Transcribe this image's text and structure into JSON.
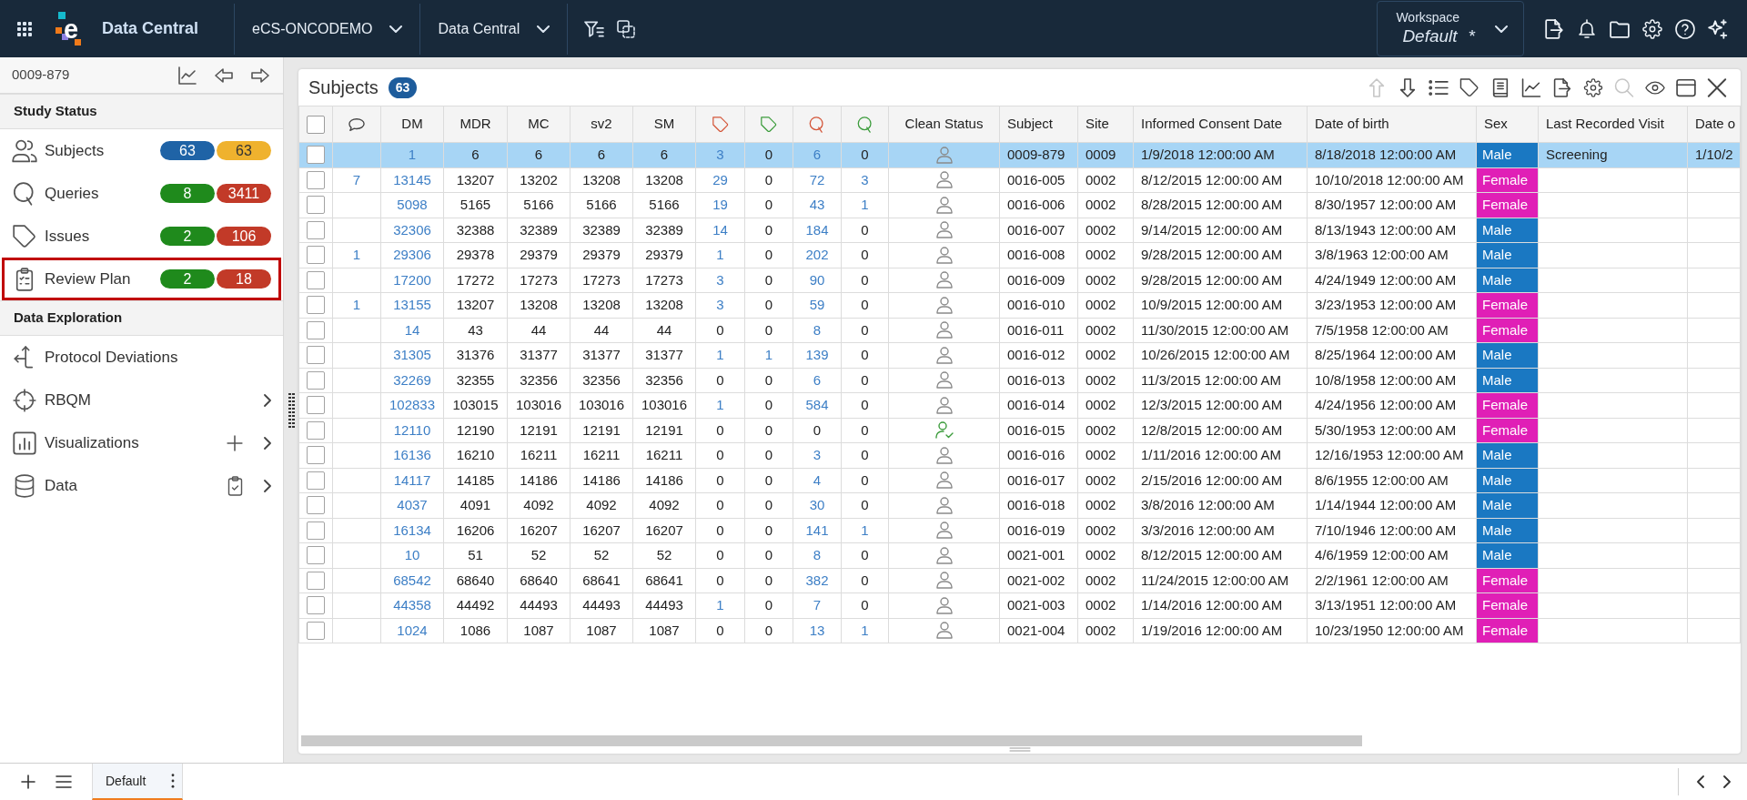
{
  "top_bar": {
    "logo_text": "e",
    "app_title": "Data Central",
    "selectors": [
      {
        "label": "eCS-ONCODEMO"
      },
      {
        "label": "Data Central"
      }
    ],
    "workspace": {
      "caption": "Workspace",
      "name": "Default",
      "modified_mark": "*"
    }
  },
  "sidebar": {
    "subject": "0009-879",
    "sections": [
      {
        "title": "Study Status",
        "items": [
          {
            "label": "Subjects",
            "highlighted": false,
            "submenu": false,
            "badges": [
              {
                "text": "63",
                "color": "#1f63a6"
              },
              {
                "text": "63",
                "color": "#efb22e"
              }
            ]
          },
          {
            "label": "Queries",
            "highlighted": false,
            "submenu": false,
            "badges": [
              {
                "text": "8",
                "color": "#1f8a1c"
              },
              {
                "text": "3411",
                "color": "#c23a28"
              }
            ]
          },
          {
            "label": "Issues",
            "highlighted": false,
            "submenu": false,
            "badges": [
              {
                "text": "2",
                "color": "#1f8a1c"
              },
              {
                "text": "106",
                "color": "#c23a28"
              }
            ]
          },
          {
            "label": "Review Plan",
            "highlighted": true,
            "submenu": false,
            "badges": [
              {
                "text": "2",
                "color": "#1f8a1c"
              },
              {
                "text": "18",
                "color": "#c23a28"
              }
            ]
          }
        ]
      },
      {
        "title": "Data Exploration",
        "items": [
          {
            "label": "Protocol Deviations",
            "highlighted": false,
            "submenu": false
          },
          {
            "label": "RBQM",
            "highlighted": false,
            "submenu": true
          },
          {
            "label": "Visualizations",
            "highlighted": false,
            "submenu": true
          },
          {
            "label": "Data",
            "highlighted": false,
            "submenu": true
          }
        ]
      }
    ]
  },
  "panel": {
    "title": "Subjects",
    "count": "63",
    "toolbar": [
      {
        "disabled": true
      },
      {
        "disabled": false
      },
      {
        "disabled": false
      },
      {
        "disabled": false
      },
      {
        "disabled": false
      },
      {
        "disabled": false
      },
      {
        "disabled": false
      },
      {
        "disabled": false
      },
      {
        "disabled": true
      },
      {
        "disabled": false
      },
      {
        "disabled": false
      },
      {
        "disabled": false
      }
    ]
  },
  "table": {
    "columns": [
      {
        "kind": "check",
        "checked": false
      },
      {
        "kind": "icon",
        "link": true
      },
      {
        "kind": "label",
        "label": "DM",
        "link": true
      },
      {
        "kind": "label",
        "label": "MDR",
        "link": false
      },
      {
        "kind": "label",
        "label": "MC",
        "link": false
      },
      {
        "kind": "label",
        "label": "sv2",
        "link": false
      },
      {
        "kind": "label",
        "label": "SM",
        "link": false
      },
      {
        "kind": "icon",
        "color": "#d4573a",
        "link": true
      },
      {
        "kind": "icon",
        "color": "#3c9c3c",
        "link": true
      },
      {
        "kind": "icon",
        "color": "#d4573a",
        "link": true
      },
      {
        "kind": "icon",
        "color": "#3c9c3c",
        "link": true
      },
      {
        "kind": "label",
        "label": "Clean Status"
      },
      {
        "kind": "label",
        "label": "Subject"
      },
      {
        "kind": "label",
        "label": "Site"
      },
      {
        "kind": "label",
        "label": "Informed Consent Date"
      },
      {
        "kind": "label",
        "label": "Date of birth"
      },
      {
        "kind": "label",
        "label": "Sex"
      },
      {
        "kind": "label",
        "label": "Last Recorded Visit"
      },
      {
        "kind": "label",
        "label": "Date o"
      }
    ],
    "rows": [
      {
        "selected": true,
        "checked": false,
        "counts": [
          "1",
          "6",
          "6",
          "6",
          "6",
          "3",
          "0",
          "6",
          "0"
        ],
        "clean": false,
        "subject": "0009-879",
        "site": "0009",
        "consent_date": "1/9/2018 12:00:00 AM",
        "birth_date": "8/18/2018 12:00:00 AM",
        "sex": {
          "label": "Male",
          "color": "#1a78c2"
        },
        "last_visit": "Screening",
        "column_19": "1/10/2"
      },
      {
        "selected": false,
        "checked": false,
        "comments": "7",
        "counts": [
          "13145",
          "13207",
          "13202",
          "13208",
          "13208",
          "29",
          "0",
          "72",
          "3"
        ],
        "clean": false,
        "subject": "0016-005",
        "site": "0002",
        "consent_date": "8/12/2015 12:00:00 AM",
        "birth_date": "10/10/2018 12:00:00 AM",
        "sex": {
          "label": "Female",
          "color": "#e01fb6"
        }
      },
      {
        "selected": false,
        "checked": false,
        "counts": [
          "5098",
          "5165",
          "5166",
          "5166",
          "5166",
          "19",
          "0",
          "43",
          "1"
        ],
        "clean": false,
        "subject": "0016-006",
        "site": "0002",
        "consent_date": "8/28/2015 12:00:00 AM",
        "birth_date": "8/30/1957 12:00:00 AM",
        "sex": {
          "label": "Female",
          "color": "#e01fb6"
        }
      },
      {
        "selected": false,
        "checked": false,
        "counts": [
          "32306",
          "32388",
          "32389",
          "32389",
          "32389",
          "14",
          "0",
          "184",
          "0"
        ],
        "clean": false,
        "subject": "0016-007",
        "site": "0002",
        "consent_date": "9/14/2015 12:00:00 AM",
        "birth_date": "8/13/1943 12:00:00 AM",
        "sex": {
          "label": "Male",
          "color": "#1a78c2"
        }
      },
      {
        "selected": false,
        "checked": false,
        "comments": "1",
        "counts": [
          "29306",
          "29378",
          "29379",
          "29379",
          "29379",
          "1",
          "0",
          "202",
          "0"
        ],
        "clean": false,
        "subject": "0016-008",
        "site": "0002",
        "consent_date": "9/28/2015 12:00:00 AM",
        "birth_date": "3/8/1963 12:00:00 AM",
        "sex": {
          "label": "Male",
          "color": "#1a78c2"
        }
      },
      {
        "selected": false,
        "checked": false,
        "counts": [
          "17200",
          "17272",
          "17273",
          "17273",
          "17273",
          "3",
          "0",
          "90",
          "0"
        ],
        "clean": false,
        "subject": "0016-009",
        "site": "0002",
        "consent_date": "9/28/2015 12:00:00 AM",
        "birth_date": "4/24/1949 12:00:00 AM",
        "sex": {
          "label": "Male",
          "color": "#1a78c2"
        }
      },
      {
        "selected": false,
        "checked": false,
        "comments": "1",
        "counts": [
          "13155",
          "13207",
          "13208",
          "13208",
          "13208",
          "3",
          "0",
          "59",
          "0"
        ],
        "clean": false,
        "subject": "0016-010",
        "site": "0002",
        "consent_date": "10/9/2015 12:00:00 AM",
        "birth_date": "3/23/1953 12:00:00 AM",
        "sex": {
          "label": "Female",
          "color": "#e01fb6"
        }
      },
      {
        "selected": false,
        "checked": false,
        "counts": [
          "14",
          "43",
          "44",
          "44",
          "44",
          "0",
          "0",
          "8",
          "0"
        ],
        "clean": false,
        "subject": "0016-011",
        "site": "0002",
        "consent_date": "11/30/2015 12:00:00 AM",
        "birth_date": "7/5/1958 12:00:00 AM",
        "sex": {
          "label": "Female",
          "color": "#e01fb6"
        }
      },
      {
        "selected": false,
        "checked": false,
        "counts": [
          "31305",
          "31376",
          "31377",
          "31377",
          "31377",
          "1",
          "1",
          "139",
          "0"
        ],
        "clean": false,
        "subject": "0016-012",
        "site": "0002",
        "consent_date": "10/26/2015 12:00:00 AM",
        "birth_date": "8/25/1964 12:00:00 AM",
        "sex": {
          "label": "Male",
          "color": "#1a78c2"
        }
      },
      {
        "selected": false,
        "checked": false,
        "counts": [
          "32269",
          "32355",
          "32356",
          "32356",
          "32356",
          "0",
          "0",
          "6",
          "0"
        ],
        "clean": false,
        "subject": "0016-013",
        "site": "0002",
        "consent_date": "11/3/2015 12:00:00 AM",
        "birth_date": "10/8/1958 12:00:00 AM",
        "sex": {
          "label": "Male",
          "color": "#1a78c2"
        }
      },
      {
        "selected": false,
        "checked": false,
        "counts": [
          "102833",
          "103015",
          "103016",
          "103016",
          "103016",
          "1",
          "0",
          "584",
          "0"
        ],
        "clean": false,
        "subject": "0016-014",
        "site": "0002",
        "consent_date": "12/3/2015 12:00:00 AM",
        "birth_date": "4/24/1956 12:00:00 AM",
        "sex": {
          "label": "Female",
          "color": "#e01fb6"
        }
      },
      {
        "selected": false,
        "checked": false,
        "counts": [
          "12110",
          "12190",
          "12191",
          "12191",
          "12191",
          "0",
          "0",
          "0",
          "0"
        ],
        "clean": true,
        "subject": "0016-015",
        "site": "0002",
        "consent_date": "12/8/2015 12:00:00 AM",
        "birth_date": "5/30/1953 12:00:00 AM",
        "sex": {
          "label": "Female",
          "color": "#e01fb6"
        }
      },
      {
        "selected": false,
        "checked": false,
        "counts": [
          "16136",
          "16210",
          "16211",
          "16211",
          "16211",
          "0",
          "0",
          "3",
          "0"
        ],
        "clean": false,
        "subject": "0016-016",
        "site": "0002",
        "consent_date": "1/11/2016 12:00:00 AM",
        "birth_date": "12/16/1953 12:00:00 AM",
        "sex": {
          "label": "Male",
          "color": "#1a78c2"
        }
      },
      {
        "selected": false,
        "checked": false,
        "counts": [
          "14117",
          "14185",
          "14186",
          "14186",
          "14186",
          "0",
          "0",
          "4",
          "0"
        ],
        "clean": false,
        "subject": "0016-017",
        "site": "0002",
        "consent_date": "2/15/2016 12:00:00 AM",
        "birth_date": "8/6/1955 12:00:00 AM",
        "sex": {
          "label": "Male",
          "color": "#1a78c2"
        }
      },
      {
        "selected": false,
        "checked": false,
        "counts": [
          "4037",
          "4091",
          "4092",
          "4092",
          "4092",
          "0",
          "0",
          "30",
          "0"
        ],
        "clean": false,
        "subject": "0016-018",
        "site": "0002",
        "consent_date": "3/8/2016 12:00:00 AM",
        "birth_date": "1/14/1944 12:00:00 AM",
        "sex": {
          "label": "Male",
          "color": "#1a78c2"
        }
      },
      {
        "selected": false,
        "checked": false,
        "counts": [
          "16134",
          "16206",
          "16207",
          "16207",
          "16207",
          "0",
          "0",
          "141",
          "1"
        ],
        "clean": false,
        "subject": "0016-019",
        "site": "0002",
        "consent_date": "3/3/2016 12:00:00 AM",
        "birth_date": "7/10/1946 12:00:00 AM",
        "sex": {
          "label": "Male",
          "color": "#1a78c2"
        }
      },
      {
        "selected": false,
        "checked": false,
        "counts": [
          "10",
          "51",
          "52",
          "52",
          "52",
          "0",
          "0",
          "8",
          "0"
        ],
        "clean": false,
        "subject": "0021-001",
        "site": "0002",
        "consent_date": "8/12/2015 12:00:00 AM",
        "birth_date": "4/6/1959 12:00:00 AM",
        "sex": {
          "label": "Male",
          "color": "#1a78c2"
        }
      },
      {
        "selected": false,
        "checked": false,
        "counts": [
          "68542",
          "68640",
          "68640",
          "68641",
          "68641",
          "0",
          "0",
          "382",
          "0"
        ],
        "clean": false,
        "subject": "0021-002",
        "site": "0002",
        "consent_date": "11/24/2015 12:00:00 AM",
        "birth_date": "2/2/1961 12:00:00 AM",
        "sex": {
          "label": "Female",
          "color": "#e01fb6"
        }
      },
      {
        "selected": false,
        "checked": false,
        "counts": [
          "44358",
          "44492",
          "44493",
          "44493",
          "44493",
          "1",
          "0",
          "7",
          "0"
        ],
        "clean": false,
        "subject": "0021-003",
        "site": "0002",
        "consent_date": "1/14/2016 12:00:00 AM",
        "birth_date": "3/13/1951 12:00:00 AM",
        "sex": {
          "label": "Female",
          "color": "#e01fb6"
        }
      },
      {
        "selected": false,
        "checked": false,
        "counts": [
          "1024",
          "1086",
          "1087",
          "1087",
          "1087",
          "0",
          "0",
          "13",
          "1"
        ],
        "clean": false,
        "subject": "0021-004",
        "site": "0002",
        "consent_date": "1/19/2016 12:00:00 AM",
        "birth_date": "10/23/1950 12:00:00 AM",
        "sex": {
          "label": "Female",
          "color": "#e01fb6"
        }
      }
    ]
  },
  "bottom_bar": {
    "tabs": [
      {
        "label": "Default",
        "selected": true
      }
    ]
  }
}
